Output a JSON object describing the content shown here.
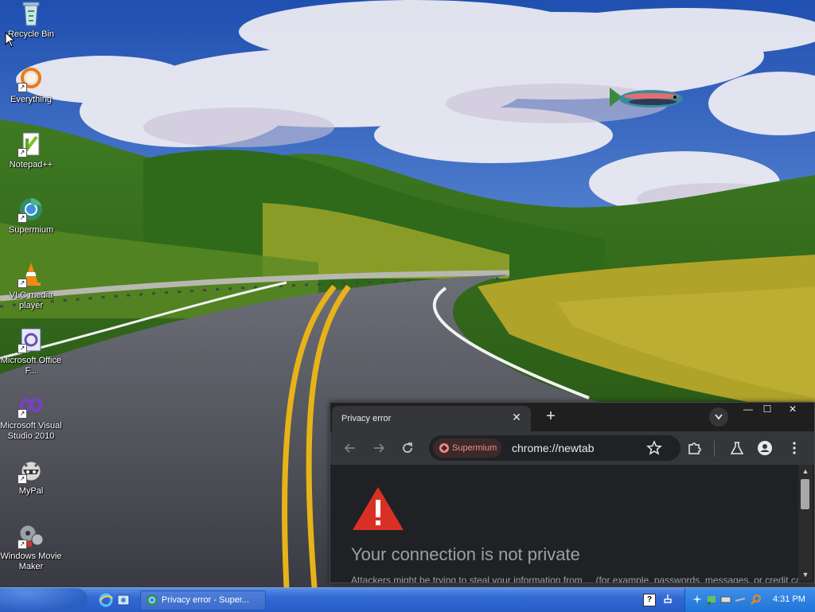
{
  "desktop": {
    "icons": [
      {
        "label": "Recycle Bin",
        "icon": "recycle-bin-icon"
      },
      {
        "label": "Everything",
        "icon": "everything-search-icon"
      },
      {
        "label": "Notepad++",
        "icon": "notepad-plus-plus-icon"
      },
      {
        "label": "Supermium",
        "icon": "supermium-browser-icon"
      },
      {
        "label": "VLC media player",
        "icon": "vlc-cone-icon"
      },
      {
        "label": "Microsoft Office F...",
        "icon": "office-document-icon"
      },
      {
        "label": "Microsoft Visual Studio 2010",
        "icon": "visual-studio-icon"
      },
      {
        "label": "MyPal",
        "icon": "mypal-raccoon-icon"
      },
      {
        "label": "Windows Movie Maker",
        "icon": "movie-maker-icon"
      }
    ]
  },
  "browser": {
    "tab_title": "Privacy error",
    "tab_close": "✕",
    "new_tab": "+",
    "window_controls": {
      "minimize": "—",
      "maximize": "☐",
      "close": "✕"
    },
    "security_chip": "Supermium",
    "url": "chrome://newtab",
    "page": {
      "headline": "Your connection is not private",
      "subline": "Attackers might be trying to steal your information from ... (for example, passwords, messages, or credit cards)."
    }
  },
  "taskbar": {
    "task_button_label": "Privacy error - Super...",
    "clock": "4:31 PM",
    "help_glyph": "?"
  },
  "colors": {
    "browser_bg": "#202124",
    "warning_red": "#d93025",
    "chip_text": "#f28b82",
    "taskbar_blue": "#3169d4"
  }
}
